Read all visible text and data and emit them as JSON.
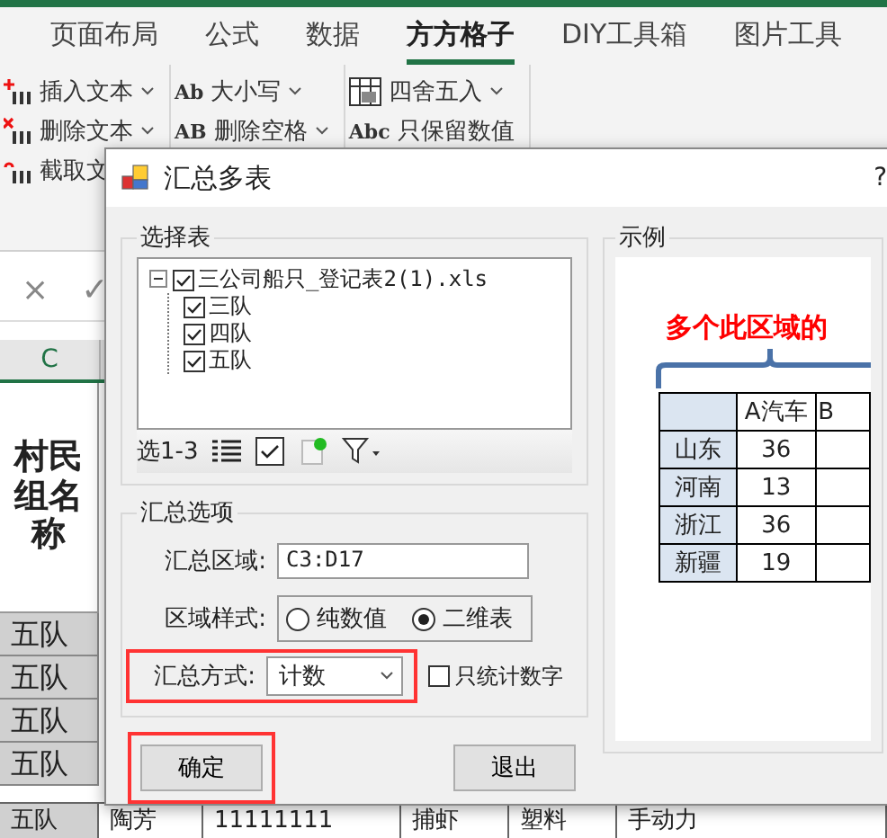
{
  "ribbon_tabs": [
    {
      "label": "页面布局",
      "selected": false
    },
    {
      "label": "公式",
      "selected": false
    },
    {
      "label": "数据",
      "selected": false
    },
    {
      "label": "方方格子",
      "selected": true
    },
    {
      "label": "DIY工具箱",
      "selected": false
    },
    {
      "label": "图片工具",
      "selected": false
    }
  ],
  "ribbon": {
    "text_tools": [
      {
        "label": "插入文本",
        "kind": "insert"
      },
      {
        "label": "删除文本",
        "kind": "delete"
      },
      {
        "label": "截取文",
        "kind": "cut"
      }
    ],
    "case_tools": [
      {
        "icon_text": "Ab",
        "label": "大小写"
      },
      {
        "icon_text": "AB",
        "label": "删除空格"
      }
    ],
    "round_tools": [
      {
        "label": "四舍五入"
      },
      {
        "icon_text": "Abc",
        "label": "只保留数值"
      }
    ]
  },
  "formula_bar": {
    "cancel_glyph": "×",
    "enter_glyph": "✓"
  },
  "sheet": {
    "column_header": "C",
    "header_cell": "村民组名称",
    "rows": [
      "五队",
      "五队",
      "五队",
      "五队"
    ],
    "last_row": [
      "五队",
      "陶芳",
      "11111111",
      "捕虾",
      "塑料",
      "手动力"
    ]
  },
  "dialog": {
    "title": "汇总多表",
    "help": "?",
    "select_group": {
      "title": "选择表",
      "tree": [
        {
          "label": "三公司船只_登记表2(1).xls",
          "checked": true,
          "expanded": true,
          "children": [
            {
              "label": "三队",
              "checked": true
            },
            {
              "label": "四队",
              "checked": true
            },
            {
              "label": "五队",
              "checked": true
            }
          ]
        }
      ],
      "toolbar_label": "选1-3"
    },
    "options_group": {
      "title": "汇总选项",
      "range_label": "汇总区域:",
      "range_value": "C3:D17",
      "style_label": "区域样式:",
      "style_options": [
        {
          "label": "纯数值",
          "selected": false
        },
        {
          "label": "二维表",
          "selected": true
        }
      ],
      "method_label": "汇总方式:",
      "method_value": "计数",
      "method_highlighted": true,
      "numbers_only": {
        "label": "只统计数字",
        "checked": false
      }
    },
    "buttons": [
      {
        "label": "确定",
        "highlighted": true
      },
      {
        "label": "退出",
        "highlighted": false
      }
    ],
    "example": {
      "title": "示例",
      "caption": "多个此区域的",
      "columns": [
        "A汽车",
        "B"
      ],
      "rows": [
        {
          "label": "山东",
          "values": [
            "36"
          ]
        },
        {
          "label": "河南",
          "values": [
            "13"
          ]
        },
        {
          "label": "浙江",
          "values": [
            "36"
          ]
        },
        {
          "label": "新疆",
          "values": [
            "19"
          ]
        }
      ]
    }
  }
}
